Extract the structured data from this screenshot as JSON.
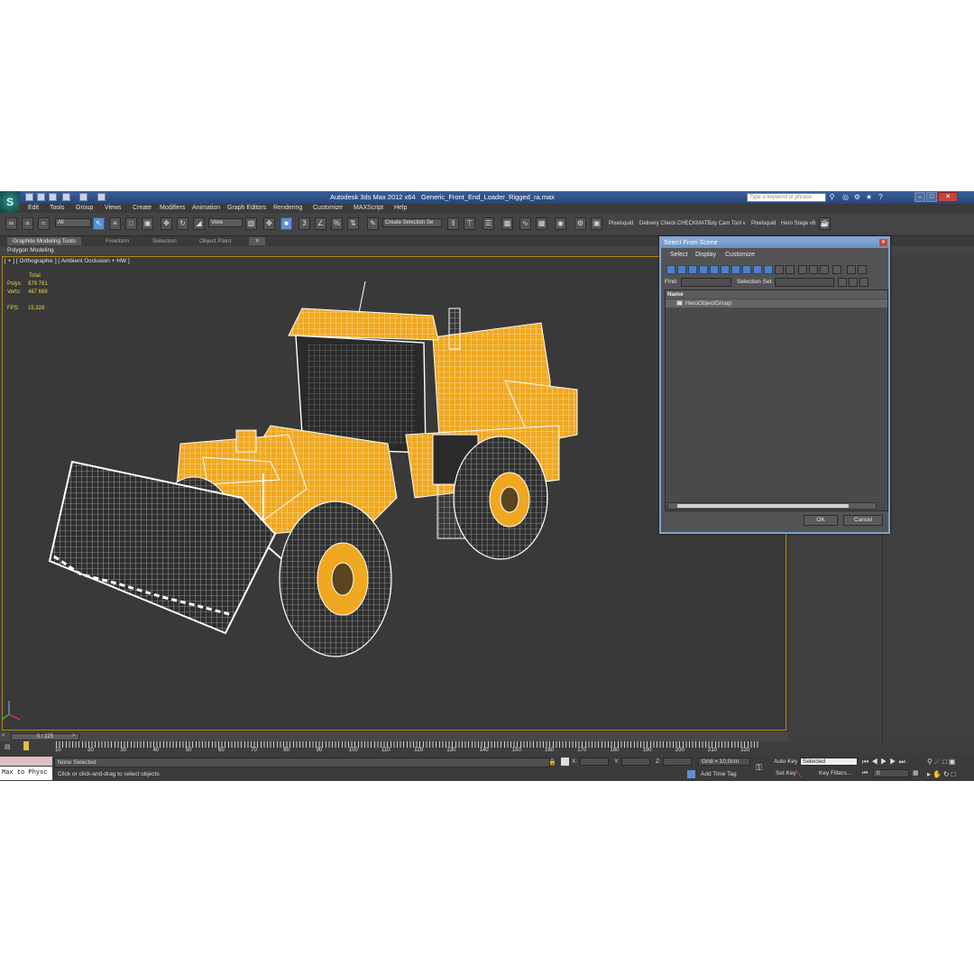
{
  "window": {
    "app_title": "Autodesk 3ds Max  2012 x64",
    "file_name": "Generic_Front_End_Loader_Rigged_ra.max",
    "search_placeholder": "Type a keyword or phrase"
  },
  "menu": [
    "Edit",
    "Tools",
    "Group",
    "Views",
    "Create",
    "Modifiers",
    "Animation",
    "Graph Editors",
    "Rendering",
    "Customize",
    "MAXScript",
    "Help"
  ],
  "toolbar": {
    "filter_value": "All",
    "refcoord_value": "View",
    "selection_set_value": "Create Selection Se",
    "plugins": [
      "Pixelsquid",
      "Delivery Check",
      "CHECKMATE",
      "uty Cam Tool v",
      "Pixelsquid",
      "Hero Stage v6"
    ]
  },
  "ribbon": {
    "tabs": [
      "Graphite Modeling Tools",
      "Freeform",
      "Selection",
      "Object Paint"
    ],
    "active_tab": "Graphite Modeling Tools",
    "panel_label": "Polygon Modeling"
  },
  "viewport": {
    "label": "[ + ] [ Orthographic ] [ Ambient Occlusion + HW ]",
    "stats": {
      "total_label": "Total",
      "polys_label": "Polys:",
      "polys_value": "879 761",
      "verts_label": "Verts:",
      "verts_value": "467 668",
      "fps_label": "FPS:",
      "fps_value": "15,328"
    }
  },
  "dialog": {
    "title": "Select From Scene",
    "menu": [
      "Select",
      "Display",
      "Customize"
    ],
    "find_label": "Find:",
    "selection_set_label": "Selection Set:",
    "column_name": "Name",
    "items": [
      "HeroObjectGroup"
    ],
    "ok_label": "OK",
    "cancel_label": "Cancel"
  },
  "timeline": {
    "slider_label": "0 / 225",
    "ticks": [
      "10",
      "20",
      "30",
      "40",
      "50",
      "60",
      "70",
      "80",
      "90",
      "100",
      "110",
      "120",
      "130",
      "140",
      "150",
      "160",
      "170",
      "180",
      "190",
      "200",
      "210",
      "220"
    ]
  },
  "status": {
    "maxscript_value": "Max to Physc",
    "selection_status": "None Selected",
    "prompt": "Click or click-and-drag to select objects",
    "x_label": "X:",
    "y_label": "Y:",
    "z_label": "Z:",
    "grid": "Grid = 10,0cm",
    "add_time_tag": "Add Time Tag",
    "auto_key": "Auto Key",
    "set_key": "Set Key",
    "key_mode_value": "Selected",
    "key_filters": "Key Filters...",
    "frame_value": "0"
  },
  "colors": {
    "model_orange": "#f0a820",
    "viewport_border": "#b38a00",
    "title_blue": "#2b4c84"
  }
}
